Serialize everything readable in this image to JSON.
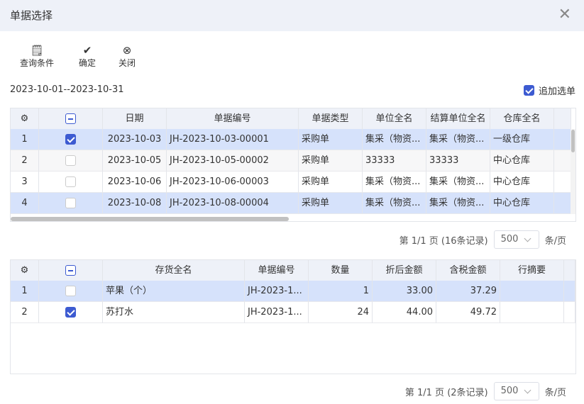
{
  "dialog": {
    "title": "单据选择"
  },
  "toolbar": {
    "query": "查询条件",
    "confirm": "确定",
    "close": "关闭"
  },
  "date_range": "2023-10-01--2023-10-31",
  "append_select": {
    "label": "追加选单",
    "checked": true
  },
  "bills": {
    "columns": [
      "日期",
      "单据编号",
      "单据类型",
      "单位全名",
      "结算单位全名",
      "仓库全名"
    ],
    "rows": [
      {
        "no": "1",
        "checked": true,
        "cells": [
          "2023-10-03",
          "JH-2023-10-03-00001",
          "采购单",
          "集采（物资...",
          "集采（物资...",
          "一级仓库"
        ]
      },
      {
        "no": "2",
        "checked": false,
        "cells": [
          "2023-10-05",
          "JH-2023-10-05-00002",
          "采购单",
          "33333",
          "33333",
          "中心仓库"
        ]
      },
      {
        "no": "3",
        "checked": false,
        "cells": [
          "2023-10-06",
          "JH-2023-10-06-00003",
          "采购单",
          "集采（物资...",
          "集采（物资...",
          "中心仓库"
        ]
      },
      {
        "no": "4",
        "checked": false,
        "cells": [
          "2023-10-08",
          "JH-2023-10-08-00004",
          "采购单",
          "集采（物资...",
          "集采（物资...",
          "中心仓库"
        ]
      }
    ],
    "pager": {
      "info": "第 1/1 页 (16条记录)",
      "page_size": "500",
      "unit": "条/页"
    }
  },
  "items": {
    "columns": [
      "存货全名",
      "单据编号",
      "数量",
      "折后金额",
      "含税金额",
      "行摘要"
    ],
    "rows": [
      {
        "no": "1",
        "checked": false,
        "cells": [
          "苹果（个）",
          "JH-2023-1...",
          "1",
          "33.00",
          "37.29",
          ""
        ]
      },
      {
        "no": "2",
        "checked": true,
        "cells": [
          "苏打水",
          "JH-2023-1...",
          "24",
          "44.00",
          "49.72",
          ""
        ]
      }
    ],
    "pager": {
      "info": "第 1/1 页 (2条记录)",
      "page_size": "500",
      "unit": "条/页"
    }
  }
}
